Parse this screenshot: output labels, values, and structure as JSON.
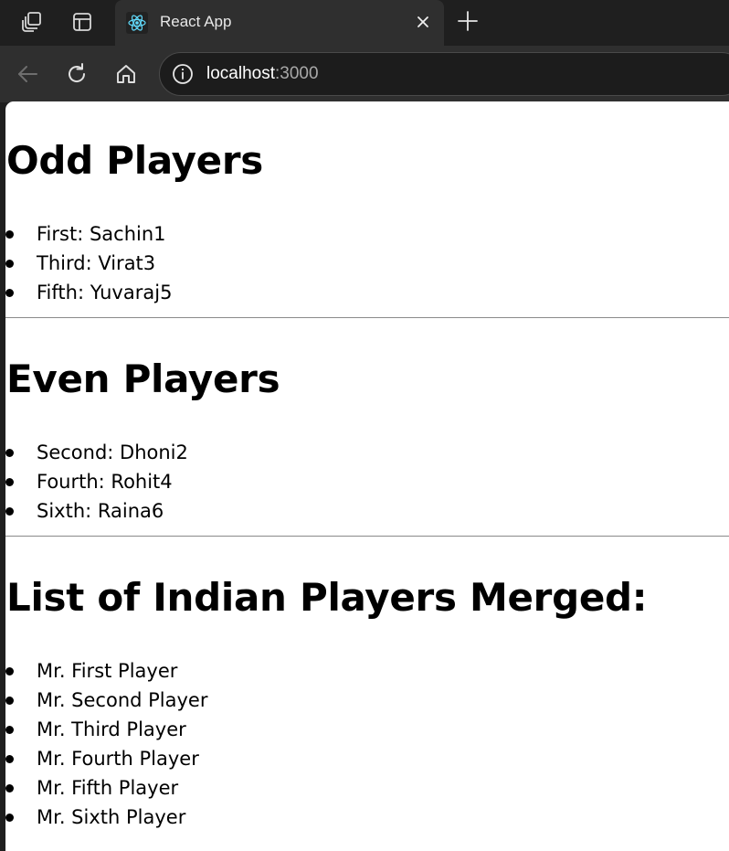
{
  "browser": {
    "tab": {
      "title": "React App",
      "favicon": "react-logo-icon"
    },
    "address_bar": {
      "host": "localhost",
      "port": ":3000"
    },
    "icons": {
      "workspaces": "workspaces-icon",
      "tab_actions": "tab-actions-icon",
      "close_tab": "close-icon",
      "new_tab": "plus-icon",
      "back": "back-arrow-icon",
      "reload": "reload-icon",
      "home": "home-icon",
      "site_info": "info-icon"
    }
  },
  "page": {
    "odd": {
      "heading": "Odd Players",
      "items": [
        "First: Sachin1",
        "Third: Virat3",
        "Fifth: Yuvaraj5"
      ]
    },
    "even": {
      "heading": "Even Players",
      "items": [
        "Second: Dhoni2",
        "Fourth: Rohit4",
        "Sixth: Raina6"
      ]
    },
    "merged": {
      "heading": "List of Indian Players Merged:",
      "items": [
        "Mr. First Player",
        "Mr. Second Player",
        "Mr. Third Player",
        "Mr. Fourth Player",
        "Mr. Fifth Player",
        "Mr. Sixth Player"
      ]
    }
  },
  "colors": {
    "chrome_dark": "#1f1f1f",
    "chrome_toolbar": "#2f2f2f",
    "page_bg": "#ffffff",
    "react_blue": "#61dafb"
  }
}
